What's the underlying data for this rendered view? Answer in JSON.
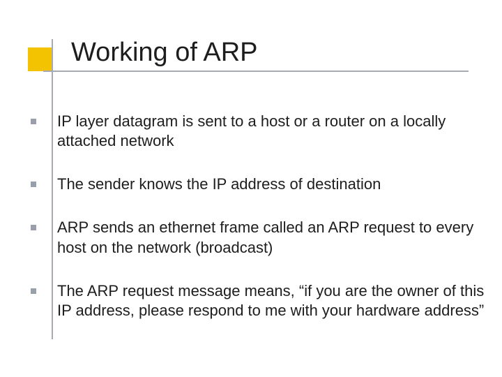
{
  "title": "Working of ARP",
  "bullets": [
    "IP layer datagram is sent to a host or a router on a locally attached network",
    "The sender knows the IP address of destination",
    "ARP sends an ethernet frame called an ARP request to every host on the network (broadcast)",
    "The ARP request message means, “if you are the owner of this IP address, please respond to me with your hardware address”"
  ]
}
